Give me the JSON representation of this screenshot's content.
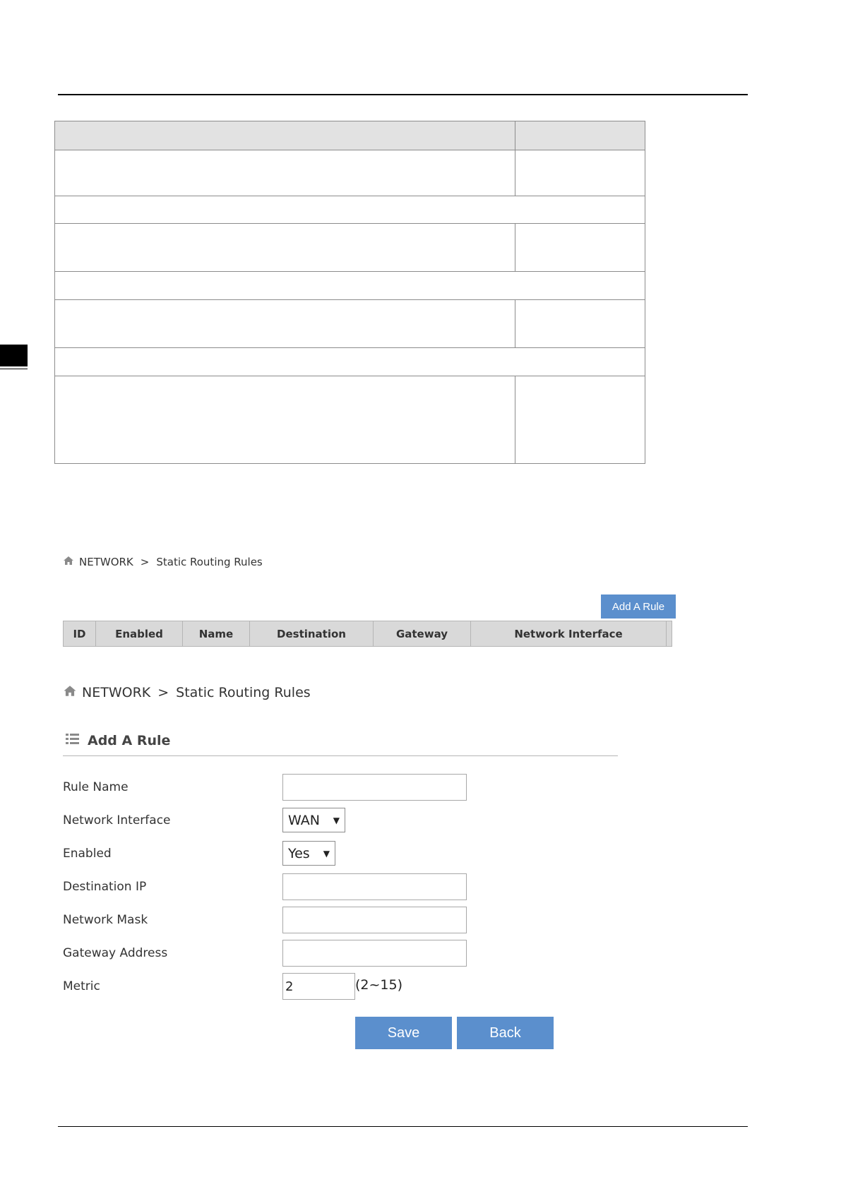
{
  "top_breadcrumb": {
    "root": "NETWORK",
    "separator": ">",
    "page": "Static Routing Rules"
  },
  "list": {
    "add_button": "Add A Rule",
    "columns": [
      "ID",
      "Enabled",
      "Name",
      "Destination",
      "Gateway",
      "Network Interface"
    ]
  },
  "form_breadcrumb": {
    "root": "NETWORK",
    "separator": ">",
    "page": "Static Routing Rules"
  },
  "form": {
    "title": "Add A Rule",
    "fields": {
      "rule_name": {
        "label": "Rule Name",
        "value": ""
      },
      "network_interface": {
        "label": "Network Interface",
        "value": "WAN"
      },
      "enabled": {
        "label": "Enabled",
        "value": "Yes"
      },
      "destination_ip": {
        "label": "Destination IP",
        "value": ""
      },
      "network_mask": {
        "label": "Network Mask",
        "value": ""
      },
      "gateway_address": {
        "label": "Gateway Address",
        "value": ""
      },
      "metric": {
        "label": "Metric",
        "value": "2",
        "range": "(2~15)"
      }
    },
    "save_label": "Save",
    "back_label": "Back"
  },
  "colors": {
    "accent": "#5b8fcd",
    "header_bg": "#d9d9d9",
    "grid_header_bg": "#e2e2e2"
  }
}
